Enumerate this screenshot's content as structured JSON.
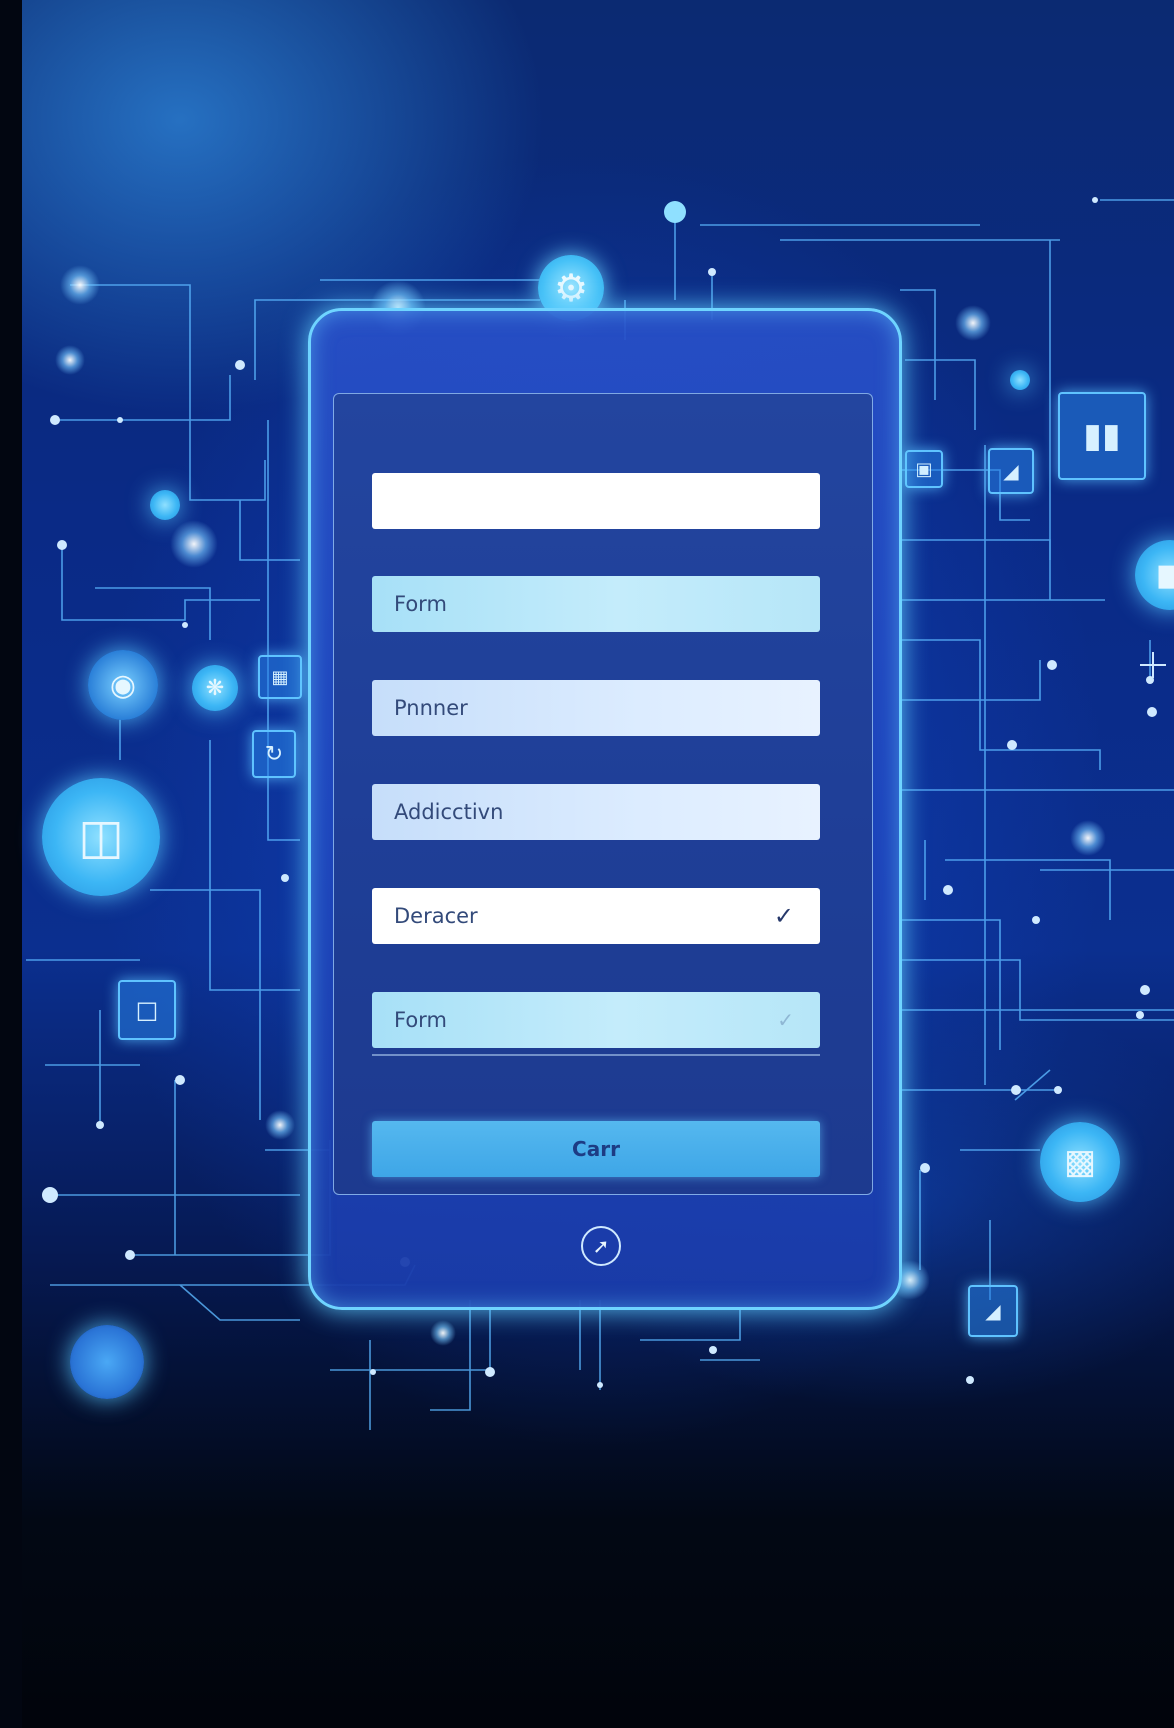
{
  "form": {
    "fields": [
      {
        "value": "",
        "style": "white",
        "check": ""
      },
      {
        "value": "Form",
        "style": "cyan",
        "check": ""
      },
      {
        "value": "Pnnner",
        "style": "light",
        "check": ""
      },
      {
        "value": "Addicctivn",
        "style": "light",
        "check": ""
      },
      {
        "value": "Deracer",
        "style": "white",
        "check": "✓"
      },
      {
        "value": "Form",
        "style": "cyan",
        "check": "✓"
      }
    ],
    "submit_label": "Carr"
  },
  "icons": {
    "device_top": "gear-icon",
    "device_home": "arrow-icon",
    "field_check": "check-icon",
    "floating": [
      "chart-icon",
      "image-icon",
      "photo-icon",
      "chat-icon",
      "folder-icon",
      "terminal-icon",
      "refresh-icon",
      "circuit-icon",
      "graph-icon",
      "tag-icon"
    ]
  },
  "colors": {
    "accent": "#6fd4ff",
    "screen": "#23459f",
    "button": "#4aaeea",
    "text": "#334a7a"
  }
}
